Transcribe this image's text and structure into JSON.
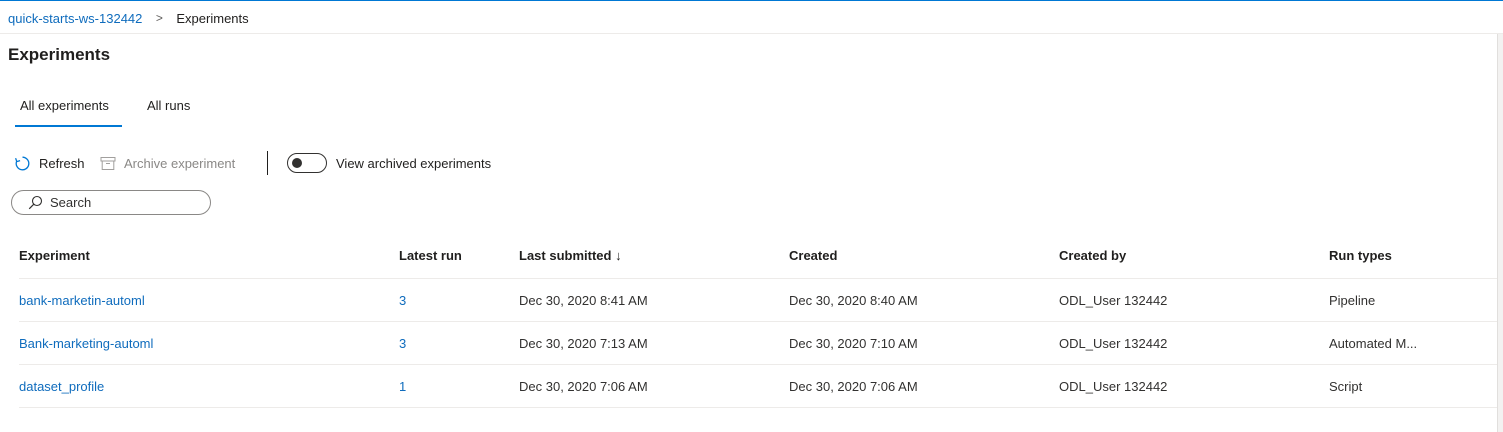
{
  "breadcrumb": {
    "workspace": "quick-starts-ws-132442",
    "separator": ">",
    "current": "Experiments"
  },
  "page_title": "Experiments",
  "tabs": [
    {
      "label": "All experiments",
      "selected": true
    },
    {
      "label": "All runs",
      "selected": false
    }
  ],
  "toolbar": {
    "refresh_label": "Refresh",
    "archive_label": "Archive experiment",
    "toggle_label": "View archived experiments",
    "toggle_on": false
  },
  "search": {
    "placeholder": "Search"
  },
  "table": {
    "headers": {
      "experiment": "Experiment",
      "latest_run": "Latest run",
      "last_submitted": "Last submitted ↓",
      "created": "Created",
      "created_by": "Created by",
      "run_types": "Run types"
    },
    "rows": [
      {
        "experiment": "bank-marketin-automl",
        "latest_run": "3",
        "last_submitted": "Dec 30, 2020 8:41 AM",
        "created": "Dec 30, 2020 8:40 AM",
        "created_by": "ODL_User 132442",
        "run_types": "Pipeline"
      },
      {
        "experiment": "Bank-marketing-automl",
        "latest_run": "3",
        "last_submitted": "Dec 30, 2020 7:13 AM",
        "created": "Dec 30, 2020 7:10 AM",
        "created_by": "ODL_User 132442",
        "run_types": "Automated M..."
      },
      {
        "experiment": "dataset_profile",
        "latest_run": "1",
        "last_submitted": "Dec 30, 2020 7:06 AM",
        "created": "Dec 30, 2020 7:06 AM",
        "created_by": "ODL_User 132442",
        "run_types": "Script"
      }
    ]
  },
  "colors": {
    "accent": "#0078d4",
    "link": "#0f6cbd",
    "text": "#201f1e",
    "disabled": "#8a8886"
  },
  "icons": {
    "refresh": "refresh-icon",
    "archive": "archive-icon",
    "search": "search-icon"
  }
}
